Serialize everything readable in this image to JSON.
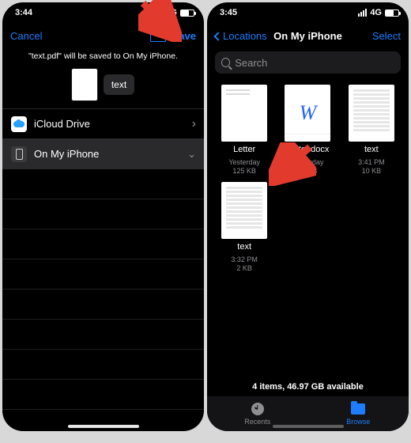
{
  "left": {
    "status": {
      "time": "3:44",
      "net": "4G"
    },
    "nav": {
      "cancel": "Cancel",
      "save": "Save"
    },
    "hint": "\"text.pdf\" will be saved to On My iPhone.",
    "file": {
      "name": "text"
    },
    "locations": {
      "icloud": "iCloud Drive",
      "onmyiphone": "On My iPhone"
    }
  },
  "right": {
    "status": {
      "time": "3:45",
      "net": "4G"
    },
    "nav": {
      "back": "Locations",
      "title": "On My iPhone",
      "select": "Select"
    },
    "search": {
      "placeholder": "Search"
    },
    "files": [
      {
        "name": "Letter",
        "line1": "Yesterday",
        "line2": "125 KB"
      },
      {
        "name": "Letter.docx",
        "line1": "Yesterday",
        "line2": "11 KB"
      },
      {
        "name": "text",
        "line1": "3:41 PM",
        "line2": "10 KB"
      },
      {
        "name": "text",
        "line1": "3:32 PM",
        "line2": "2 KB"
      }
    ],
    "summary": "4 items, 46.97 GB available",
    "tabs": {
      "recents": "Recents",
      "browse": "Browse"
    }
  }
}
